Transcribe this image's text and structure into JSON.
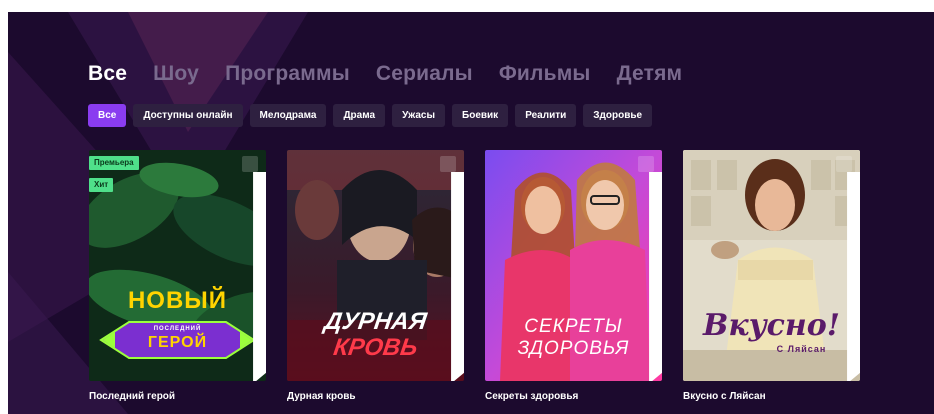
{
  "tabs": [
    {
      "label": "Все",
      "active": true
    },
    {
      "label": "Шоу",
      "active": false
    },
    {
      "label": "Программы",
      "active": false
    },
    {
      "label": "Сериалы",
      "active": false
    },
    {
      "label": "Фильмы",
      "active": false
    },
    {
      "label": "Детям",
      "active": false
    }
  ],
  "genres": [
    {
      "label": "Все",
      "active": true
    },
    {
      "label": "Доступны онлайн",
      "active": false
    },
    {
      "label": "Мелодрама",
      "active": false
    },
    {
      "label": "Драма",
      "active": false
    },
    {
      "label": "Ужасы",
      "active": false
    },
    {
      "label": "Боевик",
      "active": false
    },
    {
      "label": "Реалити",
      "active": false
    },
    {
      "label": "Здоровье",
      "active": false
    }
  ],
  "cards": [
    {
      "title": "Последний герой",
      "badges": [
        "Премьера",
        "Хит"
      ],
      "poster": {
        "line1": "НОВЫЙ",
        "line2": "ПОСЛЕДНИЙ",
        "line3": "ГЕРОЙ"
      }
    },
    {
      "title": "Дурная кровь",
      "badges": [],
      "poster": {
        "line1": "ДУРНАЯ",
        "line2": "КРОВЬ"
      }
    },
    {
      "title": "Секреты здоровья",
      "badges": [],
      "poster": {
        "line1": "СЕКРЕТЫ",
        "line2": "ЗДОРОВЬЯ"
      }
    },
    {
      "title": "Вкусно с Ляйсан",
      "badges": [],
      "poster": {
        "line1": "Вкусно!",
        "line2": "С Ляйсан"
      }
    }
  ],
  "colors": {
    "background": "#1c0a2e",
    "accent": "#8a3cf0",
    "badge": "#4fe08a"
  },
  "icons": {
    "bookmark": "bookmark-icon"
  }
}
